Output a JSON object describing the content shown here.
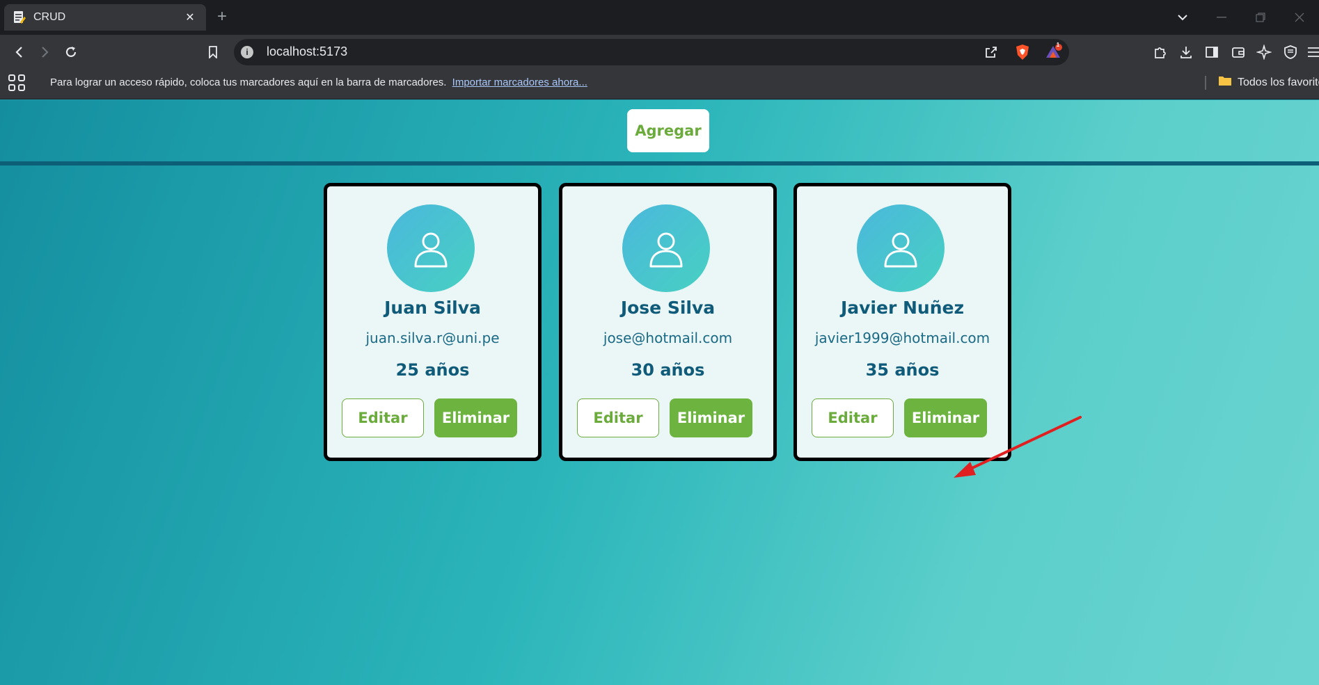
{
  "browser": {
    "tab_title": "CRUD",
    "tab_close": "✕",
    "new_tab": "+",
    "url": "localhost:5173",
    "notification_count": "1",
    "bookmarks_hint": "Para lograr un acceso rápido, coloca tus marcadores aquí en la barra de marcadores.",
    "bookmarks_import_link": "Importar marcadores ahora...",
    "bookmarks_folder": "Todos los favoritos"
  },
  "app": {
    "add_button": "Agregar",
    "cards": [
      {
        "name": "Juan Silva",
        "email": "juan.silva.r@uni.pe",
        "age": "25 años",
        "edit_label": "Editar",
        "delete_label": "Eliminar"
      },
      {
        "name": "Jose Silva",
        "email": "jose@hotmail.com",
        "age": "30 años",
        "edit_label": "Editar",
        "delete_label": "Eliminar"
      },
      {
        "name": "Javier Nuñez",
        "email": "javier1999@hotmail.com",
        "age": "35 años",
        "edit_label": "Editar",
        "delete_label": "Eliminar"
      }
    ]
  },
  "colors": {
    "accent_green": "#6db33f",
    "heading_blue": "#0f5b79",
    "annotation_red": "#e02020"
  }
}
